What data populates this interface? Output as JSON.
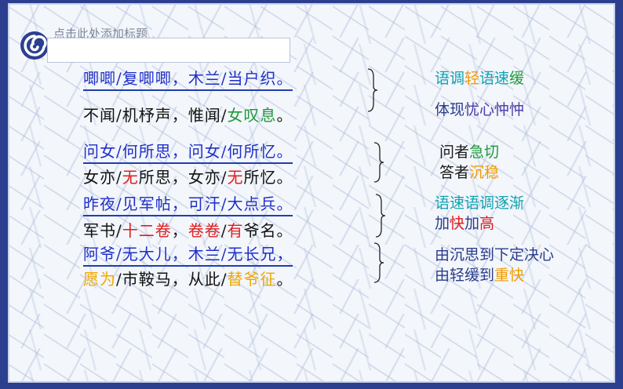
{
  "slide": {
    "title_placeholder": "点击此处添加标题",
    "lines": [
      [
        {
          "t": "唧唧/复唧唧，木兰/当户织。",
          "c": "blue"
        }
      ],
      [
        {
          "t": "不闻/机杼声，惟闻/",
          "c": ""
        },
        {
          "t": "女叹息",
          "c": "green"
        },
        {
          "t": "。",
          "c": ""
        }
      ],
      [
        {
          "t": "问女/何所思，问女/何所忆。",
          "c": "blue"
        }
      ],
      [
        {
          "t": "女亦/",
          "c": ""
        },
        {
          "t": "无",
          "c": "red"
        },
        {
          "t": "所思，女亦/",
          "c": ""
        },
        {
          "t": "无",
          "c": "red"
        },
        {
          "t": "所忆。",
          "c": ""
        }
      ],
      [
        {
          "t": "昨夜/见军帖，可汗/大点兵。",
          "c": "blue"
        }
      ],
      [
        {
          "t": "军书/",
          "c": ""
        },
        {
          "t": "十二卷",
          "c": "red"
        },
        {
          "t": "，",
          "c": ""
        },
        {
          "t": "卷卷",
          "c": "red"
        },
        {
          "t": "/",
          "c": ""
        },
        {
          "t": "有",
          "c": "red"
        },
        {
          "t": "爷名。",
          "c": ""
        }
      ],
      [
        {
          "t": "阿爷/无大儿，木兰/无长兄，",
          "c": "blue"
        }
      ],
      [
        {
          "t": "愿为",
          "c": "gold"
        },
        {
          "t": "/市鞍马，从此/",
          "c": ""
        },
        {
          "t": "替爷征",
          "c": "gold"
        },
        {
          "t": "。",
          "c": ""
        }
      ]
    ],
    "notes": [
      [
        {
          "t": "语调",
          "c": "c-teal"
        },
        {
          "t": "轻",
          "c": "c-orange"
        },
        {
          "t": "语速",
          "c": "c-teal"
        },
        {
          "t": "缓",
          "c": "c-green"
        }
      ],
      [
        {
          "t": "体现",
          "c": "c-navy"
        },
        {
          "t": "忧心忡忡",
          "c": "c-purple"
        }
      ],
      [
        {
          "t": "问者",
          "c": "c-black"
        },
        {
          "t": "急切",
          "c": "c-green"
        }
      ],
      [
        {
          "t": "答者",
          "c": "c-black"
        },
        {
          "t": "沉稳",
          "c": "c-orange"
        }
      ],
      [
        {
          "t": "语速语调逐渐",
          "c": "c-teal"
        }
      ],
      [
        {
          "t": "加",
          "c": "c-navy"
        },
        {
          "t": "快",
          "c": "c-red"
        },
        {
          "t": "加",
          "c": "c-navy"
        },
        {
          "t": "高",
          "c": "c-red"
        }
      ],
      [
        {
          "t": "由沉思到下定决心",
          "c": "c-navy"
        }
      ],
      [
        {
          "t": "由轻缓到",
          "c": "c-navy"
        },
        {
          "t": "重快",
          "c": "c-orange"
        }
      ]
    ]
  }
}
